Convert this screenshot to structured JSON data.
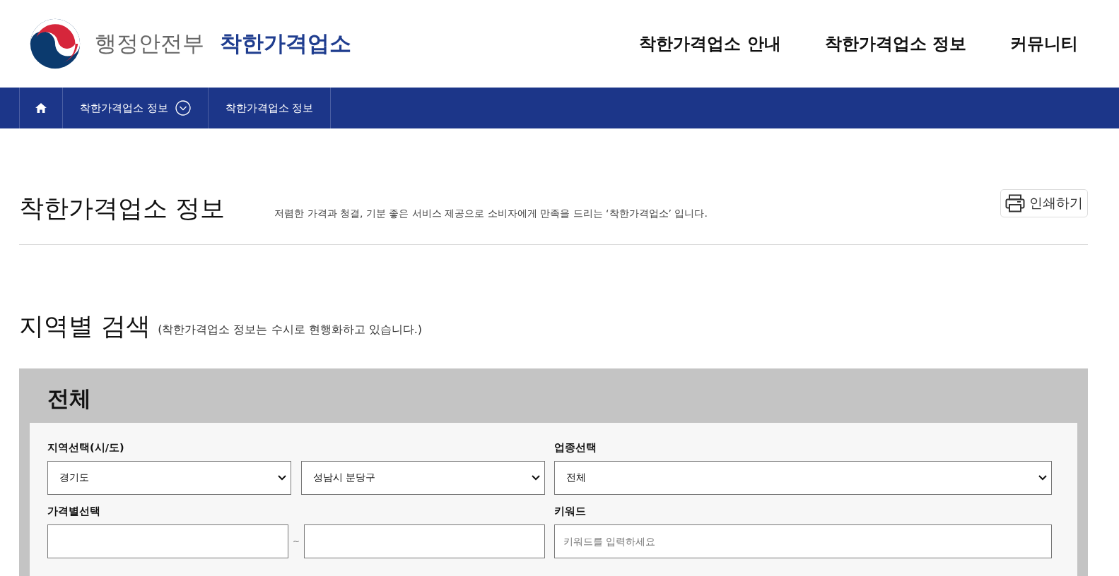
{
  "header": {
    "ministry": "행정안전부",
    "brand": "착한가격업소",
    "nav": [
      "착한가격업소 안내",
      "착한가격업소 정보",
      "커뮤니티"
    ]
  },
  "breadcrumb": [
    {
      "label": "착한가격업소 정보",
      "dropdown": true
    },
    {
      "label": "착한가격업소 정보",
      "dropdown": false
    }
  ],
  "page": {
    "title": "착한가격업소 정보",
    "description": "저렴한 가격과 청결, 기분 좋은 서비스 제공으로 소비자에게 만족을 드리는 ‘착한가격업소’ 입니다.",
    "print_button": "인쇄하기"
  },
  "search": {
    "title": "지역별 검색",
    "note": "(착한가격업소 정보는 수시로 현행화하고 있습니다.)",
    "panel_title": "전체",
    "region": {
      "label": "지역선택(시/도)",
      "selects": [
        "경기도",
        "성남시 분당구"
      ]
    },
    "category": {
      "label": "업종선택",
      "value": "전체"
    },
    "price": {
      "label": "가격별선택",
      "separator": "~"
    },
    "keyword": {
      "label": "키워드",
      "placeholder": "키워드를 입력하세요"
    }
  }
}
